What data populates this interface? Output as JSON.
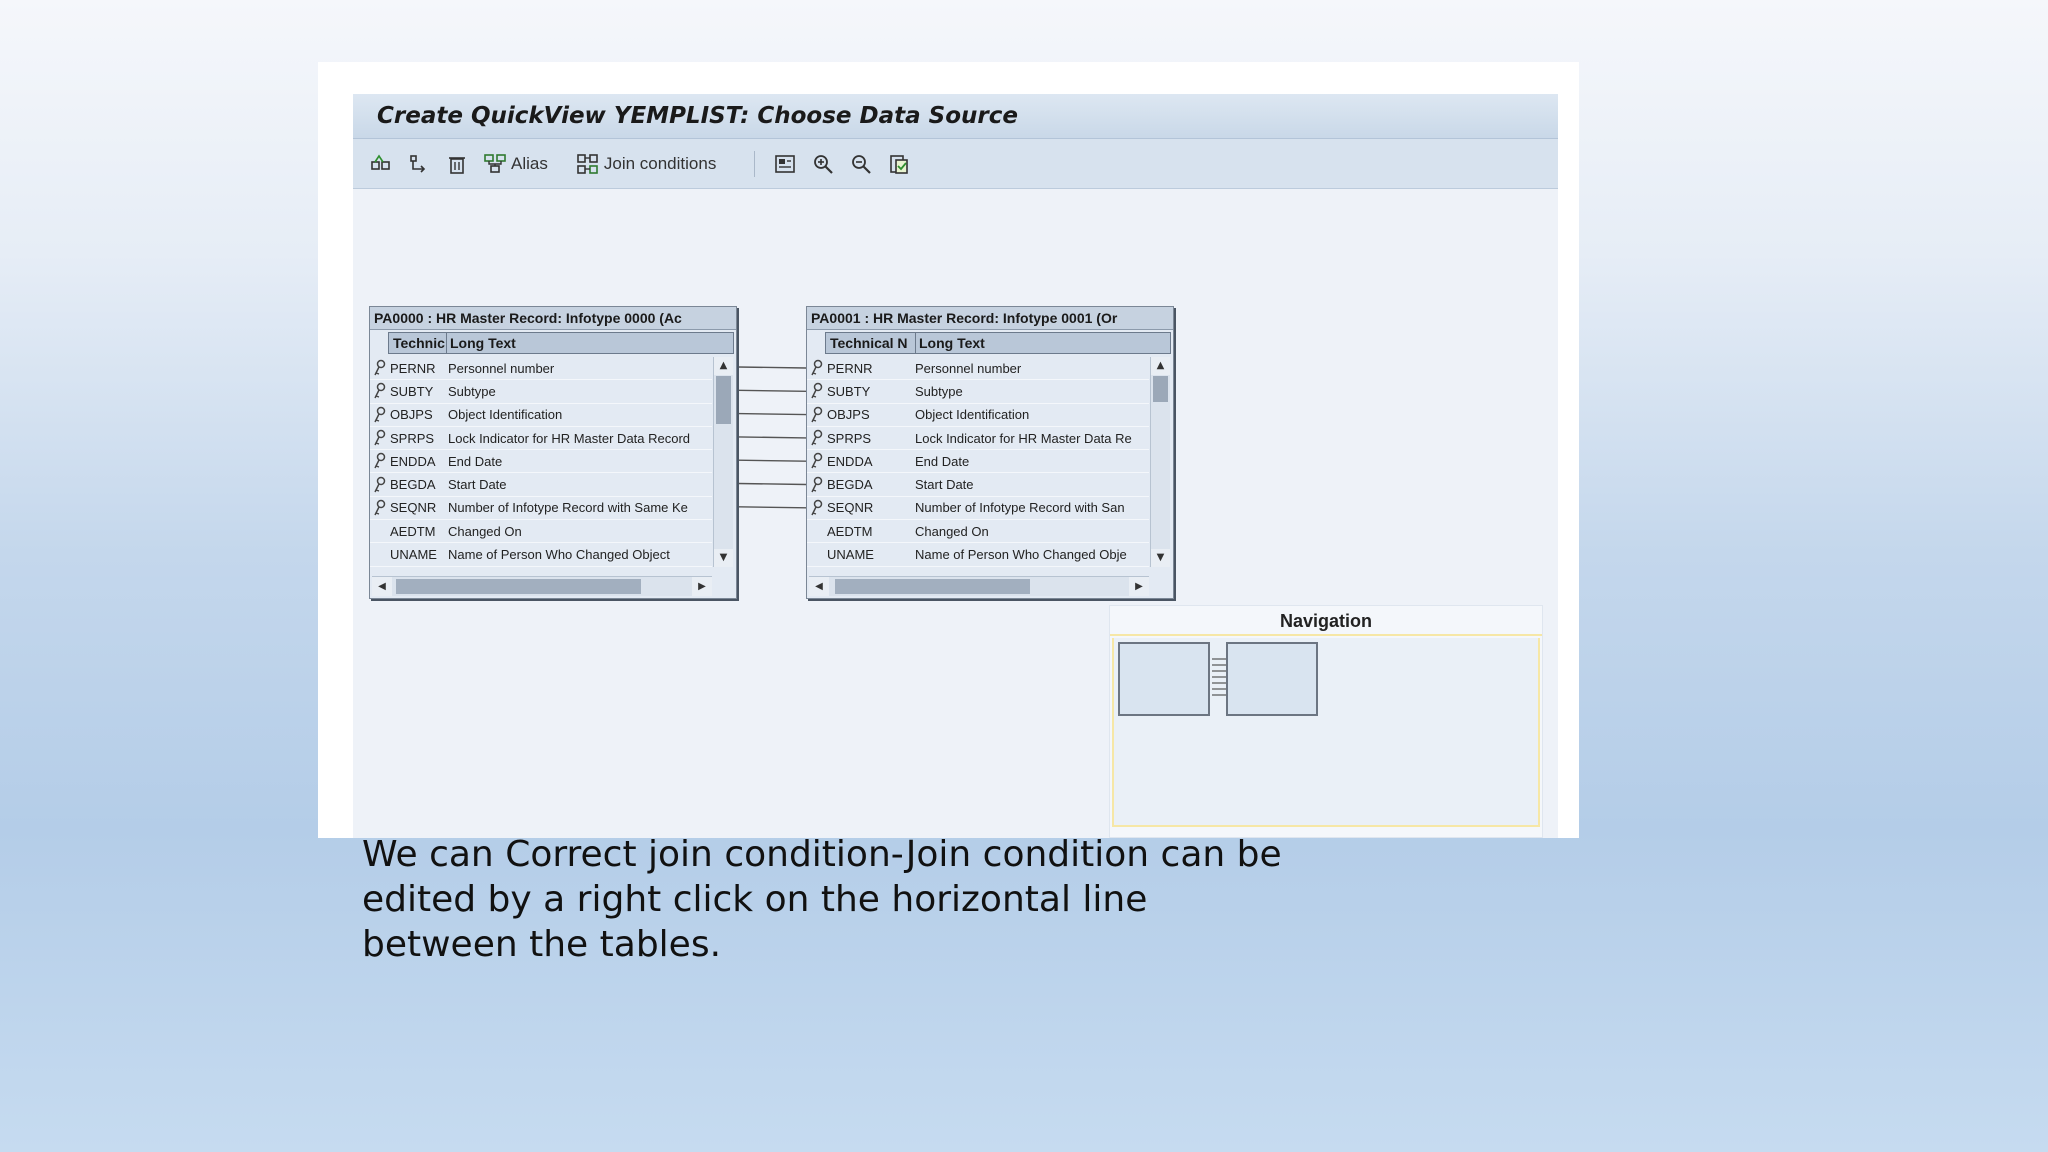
{
  "window": {
    "title": "Create QuickView YEMPLIST: Choose Data Source"
  },
  "toolbar": {
    "alias_label": "Alias",
    "join_label": "Join conditions",
    "icons": [
      "insert-table-icon",
      "remove-table-icon",
      "delete-icon",
      "alias-icon",
      "join-conditions-icon",
      "overview-icon",
      "zoom-in-icon",
      "zoom-out-icon",
      "print-icon"
    ]
  },
  "tables": [
    {
      "header": "PA0000 : HR Master Record: Infotype 0000 (Ac",
      "col_tech": "Technic",
      "col_long": "Long Text",
      "rows": [
        {
          "key": true,
          "tech": "PERNR",
          "long": "Personnel number"
        },
        {
          "key": true,
          "tech": "SUBTY",
          "long": "Subtype"
        },
        {
          "key": true,
          "tech": "OBJPS",
          "long": "Object Identification"
        },
        {
          "key": true,
          "tech": "SPRPS",
          "long": "Lock Indicator for HR Master Data Record"
        },
        {
          "key": true,
          "tech": "ENDDA",
          "long": "End Date"
        },
        {
          "key": true,
          "tech": "BEGDA",
          "long": "Start Date"
        },
        {
          "key": true,
          "tech": "SEQNR",
          "long": "Number of Infotype Record with Same Ke"
        },
        {
          "key": false,
          "tech": "AEDTM",
          "long": "Changed On"
        },
        {
          "key": false,
          "tech": "UNAME",
          "long": "Name of Person Who Changed Object"
        }
      ]
    },
    {
      "header": "PA0001 : HR Master Record: Infotype 0001 (Or",
      "col_tech": "Technical N",
      "col_long": "Long Text",
      "rows": [
        {
          "key": true,
          "tech": "PERNR",
          "long": "Personnel number"
        },
        {
          "key": true,
          "tech": "SUBTY",
          "long": "Subtype"
        },
        {
          "key": true,
          "tech": "OBJPS",
          "long": "Object Identification"
        },
        {
          "key": true,
          "tech": "SPRPS",
          "long": "Lock Indicator for HR Master Data Re"
        },
        {
          "key": true,
          "tech": "ENDDA",
          "long": "End Date"
        },
        {
          "key": true,
          "tech": "BEGDA",
          "long": "Start Date"
        },
        {
          "key": true,
          "tech": "SEQNR",
          "long": "Number of Infotype Record with San"
        },
        {
          "key": false,
          "tech": "AEDTM",
          "long": "Changed On"
        },
        {
          "key": false,
          "tech": "UNAME",
          "long": "Name of Person Who Changed Obje"
        }
      ]
    }
  ],
  "navigation": {
    "title": "Navigation"
  },
  "caption": {
    "line1": "We can Correct join condition-Join condition can be",
    "line2": "edited by a right click on the horizontal line",
    "line3": "between the tables."
  }
}
